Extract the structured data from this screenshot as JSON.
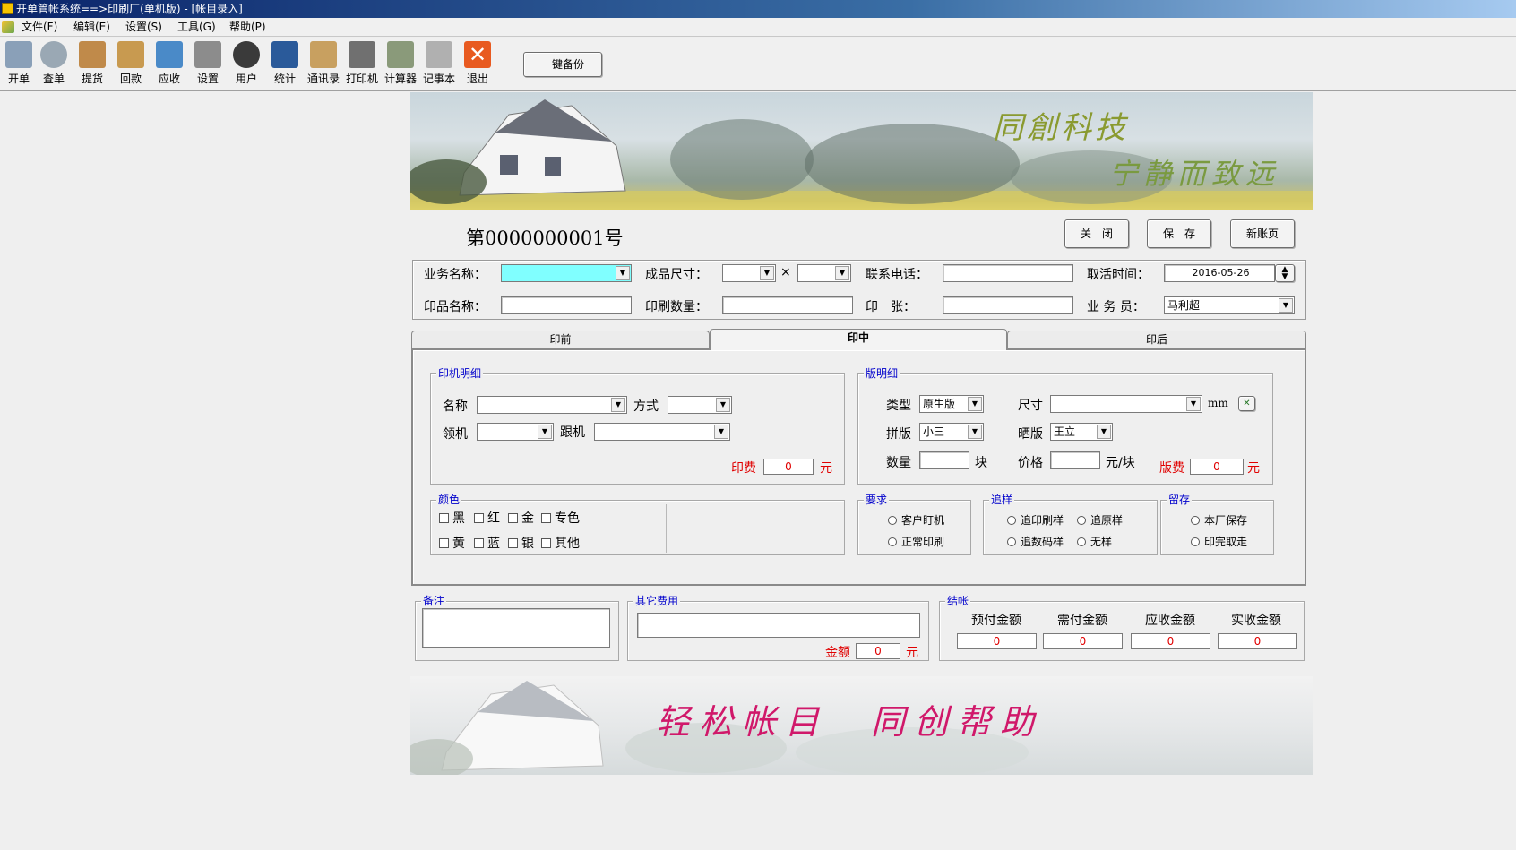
{
  "window": {
    "title": "开单管帐系统==>印刷厂(单机版) - [帐目录入]"
  },
  "menu": [
    {
      "label": "文件(F)"
    },
    {
      "label": "编辑(E)"
    },
    {
      "label": "设置(S)"
    },
    {
      "label": "工具(G)"
    },
    {
      "label": "帮助(P)"
    }
  ],
  "toolbar": {
    "items": [
      {
        "label": "开单",
        "icon": "open-bill-icon",
        "color": "#8aa0b8"
      },
      {
        "label": "查单",
        "icon": "magnifier-icon",
        "color": "#9aa8b4"
      },
      {
        "label": "提货",
        "icon": "pickup-icon",
        "color": "#c08a4a"
      },
      {
        "label": "回款",
        "icon": "box-icon",
        "color": "#c89a50"
      },
      {
        "label": "应收",
        "icon": "cube-icon",
        "color": "#4a8ac8"
      },
      {
        "label": "设置",
        "icon": "wrench-icon",
        "color": "#8c8c8c"
      },
      {
        "label": "用户",
        "icon": "user-icon",
        "color": "#3a3a3a"
      },
      {
        "label": "统计",
        "icon": "chart-icon",
        "color": "#2a5a9a"
      },
      {
        "label": "通讯录",
        "icon": "address-book-icon",
        "color": "#c8a060"
      },
      {
        "label": "打印机",
        "icon": "printer-icon",
        "color": "#707070"
      },
      {
        "label": "计算器",
        "icon": "calculator-icon",
        "color": "#8a9a7a"
      },
      {
        "label": "记事本",
        "icon": "notepad-icon",
        "color": "#b0b0b0"
      },
      {
        "label": "退出",
        "icon": "exit-icon",
        "color": "#e85a20"
      }
    ],
    "backup_label": "一键备份"
  },
  "banner_top": {
    "line1": "同創科技",
    "line2": "宁静而致远"
  },
  "banner_bottom": {
    "slogan": "轻松帐目　同创帮助"
  },
  "bill": {
    "number": "第0000000001号"
  },
  "actions": {
    "close": "关　闭",
    "save": "保　存",
    "new": "新账页"
  },
  "header_form": {
    "business_name_label": "业务名称：",
    "business_name_value": "",
    "size_label": "成品尺寸：",
    "times": "×",
    "phone_label": "联系电话：",
    "pickup_time_label": "取活时间：",
    "pickup_time_value": "2016-05-26",
    "product_name_label": "印品名称：",
    "quantity_label": "印刷数量：",
    "sheets_label": "印　张：",
    "salesman_label": "业 务 员：",
    "salesman_value": "马利超"
  },
  "tabs": [
    {
      "label": "印前"
    },
    {
      "label": "印中"
    },
    {
      "label": "印后"
    }
  ],
  "press": {
    "title": "印机明细",
    "name_label": "名称",
    "mode_label": "方式",
    "lead_label": "领机",
    "follow_label": "跟机",
    "fee_label": "印费",
    "fee_value": "0",
    "unit": "元"
  },
  "plate": {
    "title": "版明细",
    "type_label": "类型",
    "type_value": "原生版",
    "size_label": "尺寸",
    "size_unit": "mm",
    "layout_label": "拼版",
    "layout_value": "小三",
    "expose_label": "晒版",
    "expose_value": "王立",
    "qty_label": "数量",
    "qty_unit": "块",
    "price_label": "价格",
    "price_unit": "元/块",
    "fee_label": "版费",
    "fee_value": "0",
    "unit": "元"
  },
  "colors": {
    "title": "颜色",
    "row1": [
      "黑",
      "红",
      "金",
      "专色"
    ],
    "row2": [
      "黄",
      "蓝",
      "银",
      "其他"
    ]
  },
  "requirement": {
    "title": "要求",
    "options": [
      "客户盯机",
      "正常印刷"
    ]
  },
  "sample": {
    "title": "追样",
    "options": [
      "追印刷样",
      "追原样",
      "追数码样",
      "无样"
    ]
  },
  "retain": {
    "title": "留存",
    "options": [
      "本厂保存",
      "印完取走"
    ]
  },
  "remarks": {
    "title": "备注"
  },
  "other_fee": {
    "title": "其它费用",
    "amount_label": "金额",
    "amount_value": "0",
    "unit": "元"
  },
  "settle": {
    "title": "结帐",
    "columns": [
      "预付金额",
      "需付金额",
      "应收金额",
      "实收金额"
    ],
    "values": [
      "0",
      "0",
      "0",
      "0"
    ]
  }
}
